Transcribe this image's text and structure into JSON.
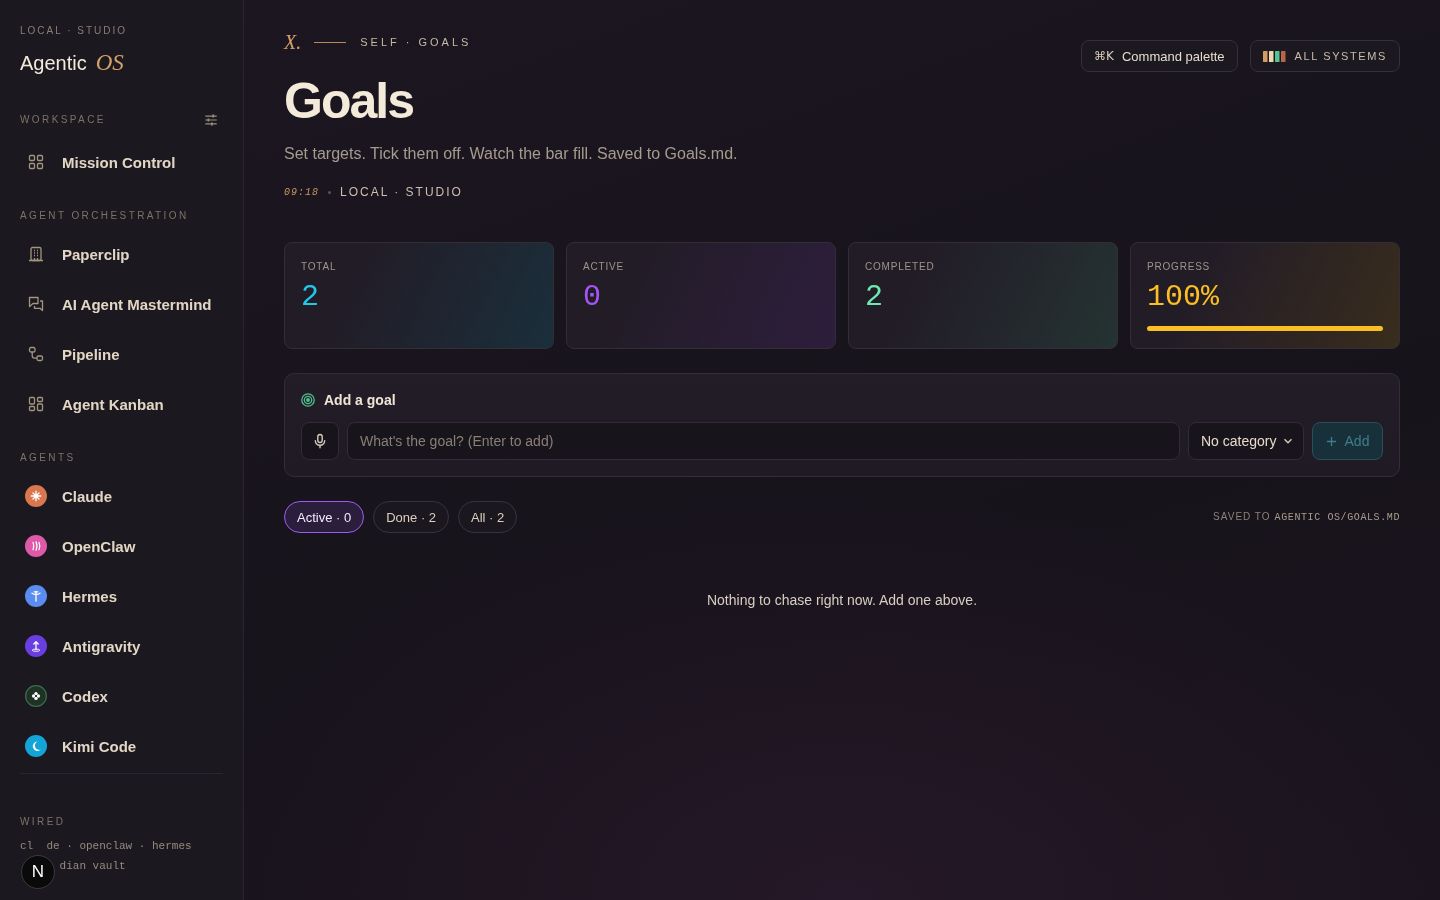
{
  "sidebar": {
    "eyebrow": "LOCAL · STUDIO",
    "brand": {
      "name": "Agentic",
      "suffix": "OS"
    },
    "workspace": {
      "title": "WORKSPACE",
      "items": [
        {
          "label": "Mission Control",
          "selected": false
        }
      ]
    },
    "orchestration": {
      "title": "AGENT ORCHESTRATION",
      "items": [
        {
          "label": "Paperclip",
          "selected": false
        },
        {
          "label": "AI Agent Mastermind",
          "selected": false
        },
        {
          "label": "Pipeline",
          "selected": false
        },
        {
          "label": "Agent Kanban",
          "selected": false
        }
      ]
    },
    "agents": {
      "title": "AGENTS",
      "items": [
        {
          "label": "Claude",
          "color": "#d9774f",
          "selected": false
        },
        {
          "label": "OpenClaw",
          "color": "#de5aa8",
          "selected": false
        },
        {
          "label": "Hermes",
          "color": "#5b8df0",
          "selected": false
        },
        {
          "label": "Antigravity",
          "color": "#6a3fe0",
          "selected": false
        },
        {
          "label": "Codex",
          "color": "#1e3326",
          "selected": false
        },
        {
          "label": "Kimi Code",
          "color": "#12a5d6",
          "selected": false
        }
      ]
    },
    "wired": {
      "title": "WIRED",
      "lines": [
        [
          "cl",
          "de · openclaw · hermes"
        ],
        [
          "dian vault"
        ]
      ]
    }
  },
  "dev_badge": {
    "label": "N"
  },
  "header": {
    "mark": "X.",
    "eyebrow": "SELF · GOALS",
    "title": "Goals",
    "subtitle": "Set targets. Tick them off. Watch the bar fill. Saved to Goals.md.",
    "time": "09:18",
    "location": "LOCAL · STUDIO",
    "actions": [
      {
        "kind": "palette",
        "shortcut": "⌘K",
        "label": "Command palette"
      },
      {
        "kind": "status",
        "label": "ALL SYSTEMS"
      }
    ]
  },
  "stats": [
    {
      "kind": "count",
      "label": "TOTAL",
      "value": "2",
      "color": "#22c8e8"
    },
    {
      "kind": "count",
      "label": "ACTIVE",
      "value": "0",
      "color": "#a855f7"
    },
    {
      "kind": "count",
      "label": "COMPLETED",
      "value": "2",
      "color": "#6ee7b0"
    },
    {
      "kind": "meter",
      "label": "PROGRESS",
      "value": "100%",
      "color": "#fbbf24",
      "level": 1
    }
  ],
  "add_goal": {
    "title": "Add a goal",
    "placeholder": "What's the goal? (Enter to add)",
    "category": "No category",
    "add_button": {
      "label": "Add",
      "disabled": true
    }
  },
  "filters": [
    {
      "label": "Active · 0",
      "selected": true
    },
    {
      "label": "Done · 2",
      "selected": false
    },
    {
      "label": "All · 2",
      "selected": false
    }
  ],
  "saved_note": {
    "label": "SAVED TO",
    "path": "AGENTIC OS/GOALS.MD"
  },
  "empty_state": "Nothing to chase right now. Add one above."
}
